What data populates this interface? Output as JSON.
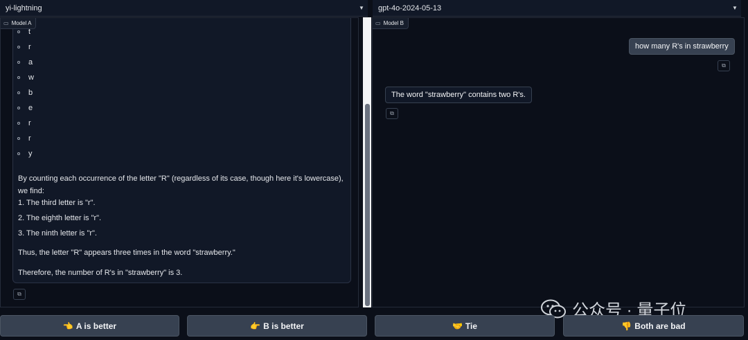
{
  "model_a": {
    "selector_value": "yi-lightning",
    "tag_label": "Model A",
    "letters": [
      "t",
      "r",
      "a",
      "w",
      "b",
      "e",
      "r",
      "r",
      "y"
    ],
    "paragraphs": [
      "By counting each occurrence of the letter \"R\" (regardless of its case, though here it's lowercase), we find:",
      "1. The third letter is \"r\".",
      "2. The eighth letter is \"r\".",
      "3. The ninth letter is \"r\".",
      "Thus, the letter \"R\" appears three times in the word \"strawberry.\"",
      "Therefore, the number of R's in \"strawberry\" is 3."
    ]
  },
  "model_b": {
    "selector_value": "gpt-4o-2024-05-13",
    "tag_label": "Model B",
    "user_message": "how many R's in strawberry",
    "bot_message": "The word \"strawberry\" contains two R's."
  },
  "vote_buttons": {
    "a_better": {
      "emoji": "👈",
      "label": "A is better"
    },
    "b_better": {
      "emoji": "👉",
      "label": "B is better"
    },
    "tie": {
      "emoji": "🤝",
      "label": "Tie"
    },
    "both_bad": {
      "emoji": "👎",
      "label": "Both are bad"
    }
  },
  "watermark": {
    "text": "公众号 · 量子位"
  },
  "colors": {
    "background": "#0b0f19",
    "panel": "#111827",
    "button": "#374151",
    "border": "#2b3345"
  },
  "icons": {
    "dropdown": "chevron-down-icon",
    "tag": "chat-icon",
    "copy": "copy-icon"
  }
}
